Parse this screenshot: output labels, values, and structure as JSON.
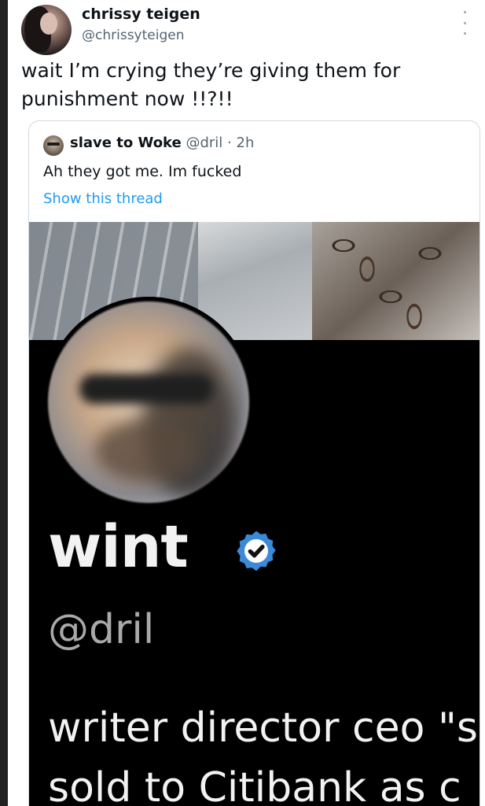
{
  "author": {
    "display_name": "chrissy teigen",
    "handle": "@chrissyteigen",
    "avatar_icon": "profile-photo"
  },
  "tweet": {
    "text_line1": "wait I’m crying they’re giving them for",
    "text_line2": "punishment now !!?!!"
  },
  "quoted": {
    "display_name": "slave to Woke",
    "handle": "@dril",
    "separator": "·",
    "time": "2h",
    "text": "Ah they got me. Im fucked",
    "thread_link": "Show this thread"
  },
  "media": {
    "profile_name": "wint",
    "profile_handle": "@dril",
    "bio_line1": "writer director ceo \"s",
    "bio_line2": "sold to Citibank as c",
    "verified_icon": "verified-badge",
    "verified_color": "#3b8ad9"
  },
  "colors": {
    "link": "#1d9bf0",
    "secondary_text": "#536471",
    "primary_text": "#0f1419"
  }
}
